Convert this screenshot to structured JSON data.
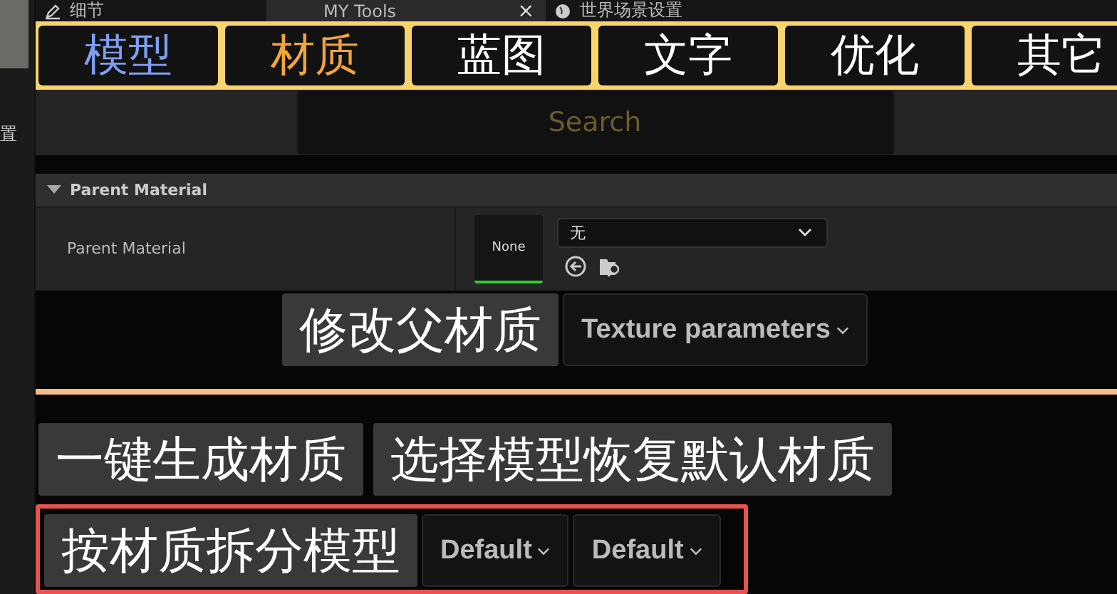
{
  "sidebar": {
    "label": "置"
  },
  "top_tabs": [
    {
      "label": "细节",
      "selected": false
    },
    {
      "label": "MY Tools",
      "selected": true,
      "close": "×"
    },
    {
      "label": "世界场景设置",
      "selected": false
    }
  ],
  "category_tabs": [
    {
      "label": "模型",
      "selected": false,
      "hovered": true
    },
    {
      "label": "材质",
      "selected": true,
      "hovered": false
    },
    {
      "label": "蓝图",
      "selected": false,
      "hovered": false
    },
    {
      "label": "文字",
      "selected": false,
      "hovered": false
    },
    {
      "label": "优化",
      "selected": false,
      "hovered": false
    },
    {
      "label": "其它",
      "selected": false,
      "hovered": false
    }
  ],
  "search": {
    "placeholder": "Search"
  },
  "section": {
    "title": "Parent Material",
    "expanded": true,
    "property": {
      "label": "Parent Material",
      "thumbnail": "None",
      "value": "无"
    }
  },
  "rows": [
    {
      "highlighted": false,
      "items": [
        {
          "kind": "button",
          "label": "修改父材质"
        },
        {
          "kind": "dropdown",
          "label": "Texture parameters"
        }
      ]
    },
    {
      "highlighted": false,
      "items": [
        {
          "kind": "button",
          "label": "一键生成材质"
        },
        {
          "kind": "button",
          "label": "选择模型恢复默认材质"
        }
      ]
    },
    {
      "highlighted": true,
      "items": [
        {
          "kind": "button",
          "label": "按材质拆分模型"
        },
        {
          "kind": "dropdown",
          "label": "Default"
        },
        {
          "kind": "dropdown",
          "label": "Default"
        }
      ]
    }
  ]
}
